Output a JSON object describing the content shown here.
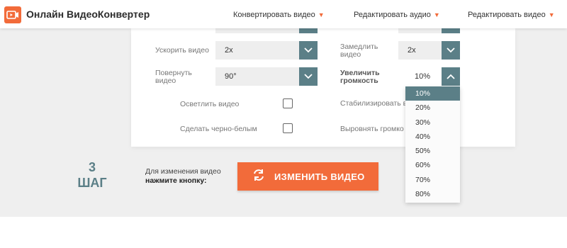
{
  "header": {
    "brand": "Онлайн ВидеоКонвертер",
    "nav": [
      {
        "label": "Конвертировать видео"
      },
      {
        "label": "Редактировать аудио"
      },
      {
        "label": "Редактировать видео"
      }
    ],
    "dropdown_marker": "▼"
  },
  "settings": {
    "speed_up": {
      "label": "Ускорить видео",
      "value": "2x"
    },
    "slow_down": {
      "label": "Замедлить видео",
      "value": "2x"
    },
    "rotate": {
      "label": "Повернуть видео",
      "value": "90°"
    },
    "volume": {
      "label": "Увеличить громкость",
      "value": "10%",
      "expanded": true
    },
    "brighten": {
      "label": "Осветлить видео",
      "checked": false
    },
    "stabilize": {
      "label": "Стабилизировать в",
      "checked": false
    },
    "grayscale": {
      "label": "Сделать черно-белым",
      "checked": false
    },
    "normalize": {
      "label": "Выровнять громко",
      "checked": false
    }
  },
  "volume_options": [
    "10%",
    "20%",
    "30%",
    "40%",
    "50%",
    "60%",
    "70%",
    "80%"
  ],
  "volume_selected": "10%",
  "step": {
    "number": "3",
    "word": "ШАГ"
  },
  "hint": {
    "line1": "Для изменения видео",
    "line2": "нажмите кнопку:"
  },
  "cta": {
    "label": "ИЗМЕНИТЬ ВИДЕО",
    "icon": "refresh-icon"
  },
  "colors": {
    "accent": "#f26b3a",
    "teal": "#5b7f87",
    "band": "#efefef"
  }
}
